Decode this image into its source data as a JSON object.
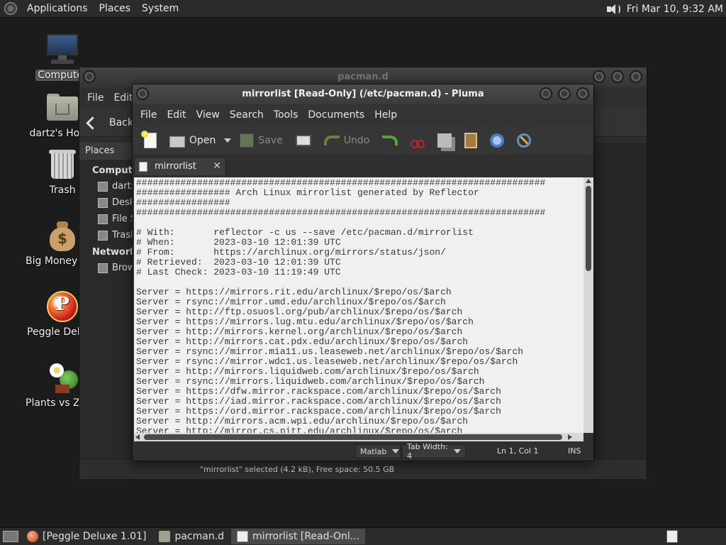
{
  "top_panel": {
    "menus": [
      "Applications",
      "Places",
      "System"
    ],
    "clock": "Fri Mar 10,  9:32 AM",
    "volume_icon": "speaker-icon"
  },
  "desktop": {
    "icons": [
      {
        "label": "Computer",
        "icon": "computer-icon"
      },
      {
        "label": "dartz's Home",
        "icon": "home-folder-icon"
      },
      {
        "label": "Trash",
        "icon": "trash-icon"
      },
      {
        "label": "Big Money Deluxe",
        "icon": "money-bag-icon"
      },
      {
        "label": "Peggle Deluxe",
        "icon": "peggle-icon"
      },
      {
        "label": "Plants vs Zombies",
        "icon": "plants-icon"
      }
    ]
  },
  "caja": {
    "title": "pacman.d",
    "menus": [
      "File",
      "Edit"
    ],
    "back_label": "Back",
    "places_label": "Places",
    "sidebar": {
      "computer_header": "Computer",
      "items": [
        {
          "label": "dartz",
          "icon": "home-icon"
        },
        {
          "label": "Desktop",
          "icon": "desktop-icon"
        },
        {
          "label": "File System",
          "icon": "drive-icon"
        },
        {
          "label": "Trash",
          "icon": "trash-icon"
        }
      ],
      "network_header": "Network",
      "network_items": [
        {
          "label": "Browse Network",
          "icon": "network-icon"
        }
      ]
    },
    "status": "\"mirrorlist\" selected (4.2 kB), Free space: 50.5 GB"
  },
  "pluma": {
    "title": "mirrorlist [Read-Only] (/etc/pacman.d) - Pluma",
    "menus": [
      "File",
      "Edit",
      "View",
      "Search",
      "Tools",
      "Documents",
      "Help"
    ],
    "toolbar": {
      "open": "Open",
      "save": "Save",
      "undo": "Undo"
    },
    "tab_label": "mirrorlist",
    "tab_close": "✕",
    "content_lines": [
      "##########################################################################",
      "################# Arch Linux mirrorlist generated by Reflector",
      "#################",
      "##########################################################################",
      "",
      "# With:       reflector -c us --save /etc/pacman.d/mirrorlist",
      "# When:       2023-03-10 12:01:39 UTC",
      "# From:       https://archlinux.org/mirrors/status/json/",
      "# Retrieved:  2023-03-10 12:01:39 UTC",
      "# Last Check: 2023-03-10 11:19:49 UTC",
      "",
      "Server = https://mirrors.rit.edu/archlinux/$repo/os/$arch",
      "Server = rsync://mirror.umd.edu/archlinux/$repo/os/$arch",
      "Server = http://ftp.osuosl.org/pub/archlinux/$repo/os/$arch",
      "Server = https://mirrors.lug.mtu.edu/archlinux/$repo/os/$arch",
      "Server = http://mirrors.kernel.org/archlinux/$repo/os/$arch",
      "Server = http://mirrors.cat.pdx.edu/archlinux/$repo/os/$arch",
      "Server = rsync://mirror.mia11.us.leaseweb.net/archlinux/$repo/os/$arch",
      "Server = rsync://mirror.wdc1.us.leaseweb.net/archlinux/$repo/os/$arch",
      "Server = http://mirrors.liquidweb.com/archlinux/$repo/os/$arch",
      "Server = rsync://mirrors.liquidweb.com/archlinux/$repo/os/$arch",
      "Server = https://dfw.mirror.rackspace.com/archlinux/$repo/os/$arch",
      "Server = https://iad.mirror.rackspace.com/archlinux/$repo/os/$arch",
      "Server = https://ord.mirror.rackspace.com/archlinux/$repo/os/$arch",
      "Server = http://mirrors.acm.wpi.edu/archlinux/$repo/os/$arch",
      "Server = http://mirror.cs.pitt.edu/archlinux/$repo/os/$arch"
    ],
    "status": {
      "language": "Matlab",
      "tab_width": "Tab Width:  4",
      "position": "Ln 1, Col 1",
      "mode": "INS"
    }
  },
  "taskbar": {
    "tasks": [
      {
        "label": "[Peggle Deluxe 1.01]",
        "icon": "peggle-icon"
      },
      {
        "label": "pacman.d",
        "icon": "folder-icon"
      },
      {
        "label": "mirrorlist [Read-Onl...",
        "icon": "text-editor-icon"
      }
    ]
  }
}
